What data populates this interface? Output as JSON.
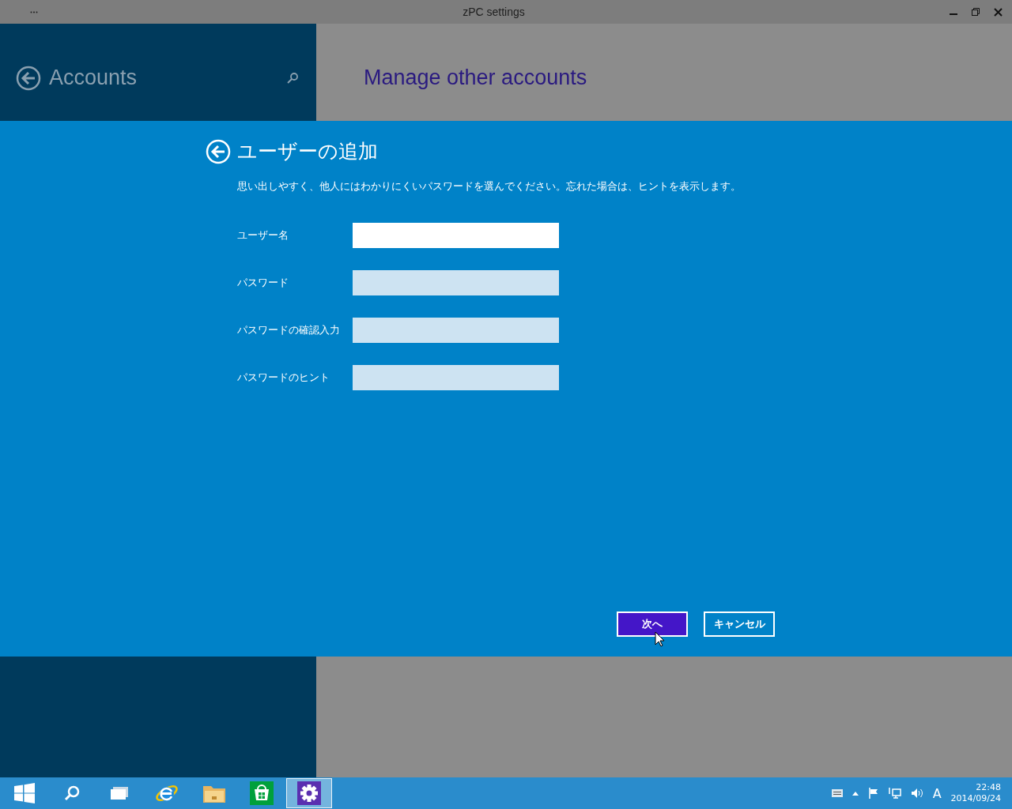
{
  "window": {
    "title": "zPC settings"
  },
  "settings_pane": {
    "title": "Accounts"
  },
  "content": {
    "heading": "Manage other accounts"
  },
  "dialog": {
    "title": "ユーザーの追加",
    "description": "思い出しやすく、他人にはわかりにくいパスワードを選んでください。忘れた場合は、ヒントを表示します。",
    "fields": [
      {
        "label": "ユーザー名",
        "focused": true
      },
      {
        "label": "パスワード",
        "focused": false
      },
      {
        "label": "パスワードの確認入力",
        "focused": false
      },
      {
        "label": "パスワードのヒント",
        "focused": false
      }
    ],
    "buttons": [
      {
        "label": "次へ",
        "kind": "primary"
      },
      {
        "label": "キャンセル",
        "kind": "secondary"
      }
    ]
  },
  "taskbar": {
    "items": [
      {
        "kind": "start",
        "selected": false
      },
      {
        "kind": "search",
        "selected": false
      },
      {
        "kind": "task-view",
        "selected": false
      },
      {
        "kind": "browser",
        "selected": false
      },
      {
        "kind": "folder",
        "selected": false
      },
      {
        "kind": "store",
        "selected": false
      },
      {
        "kind": "settings",
        "selected": true
      }
    ],
    "ime": "A",
    "time": "22:48",
    "date": "2014/09/24"
  }
}
